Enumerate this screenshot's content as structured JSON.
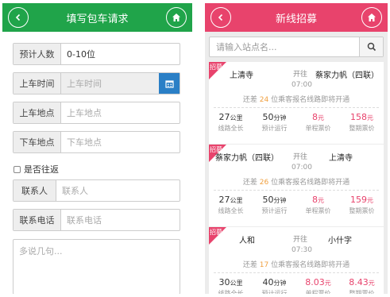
{
  "left": {
    "title": "填写包车请求",
    "back_icon": "chevron-left-icon",
    "home_icon": "home-icon",
    "header_color": "#20a44a",
    "fields": {
      "people": {
        "label": "预计人数",
        "value": "0-10位"
      },
      "time": {
        "label": "上车时间",
        "placeholder": "上车时间",
        "icon": "calendar-icon"
      },
      "pickup": {
        "label": "上车地点",
        "placeholder": "上车地点"
      },
      "dropoff": {
        "label": "下车地点",
        "placeholder": "下车地点"
      },
      "round_trip": {
        "label": "是否往返",
        "checked": false
      },
      "contact": {
        "label": "联系人",
        "placeholder": "联系人"
      },
      "phone": {
        "label": "联系电话",
        "placeholder": "联系电话"
      },
      "remarks": {
        "placeholder": "多说几句..."
      }
    }
  },
  "right": {
    "title": "新线招募",
    "header_color": "#e8436c",
    "search": {
      "placeholder": "请输入站点名...",
      "icon": "search-icon"
    },
    "open_label": "开往",
    "note_prefix": "还差",
    "note_suffix": "位乘客报名线路即将开通",
    "stat_labels": [
      "线路全长",
      "预计运行",
      "单程票价",
      "整期票价"
    ],
    "cards": [
      {
        "badge": "招募",
        "from": "上清寺",
        "to": "蔡家力帆（四联）",
        "time": "07:00",
        "needed": "24",
        "distance": "27",
        "distance_unit": "公里",
        "duration": "50",
        "duration_unit": "分钟",
        "single_price": "8",
        "single_unit": "元",
        "period_price": "158",
        "period_unit": "元"
      },
      {
        "badge": "招募",
        "from": "蔡家力帆（四联）",
        "to": "上清寺",
        "time": "07:00",
        "needed": "26",
        "distance": "27",
        "distance_unit": "公里",
        "duration": "50",
        "duration_unit": "分钟",
        "single_price": "8",
        "single_unit": "元",
        "period_price": "159",
        "period_unit": "元"
      },
      {
        "badge": "招募",
        "from": "人和",
        "to": "小什字",
        "time": "07:30",
        "needed": "17",
        "distance": "30",
        "distance_unit": "公里",
        "duration": "40",
        "duration_unit": "分钟",
        "single_price": "8.03",
        "single_unit": "元",
        "period_price": "8.43",
        "period_unit": "元"
      }
    ]
  }
}
